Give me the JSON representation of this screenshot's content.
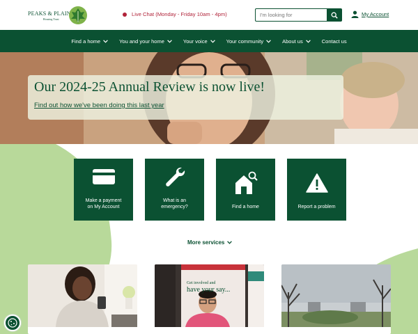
{
  "header": {
    "logo_name": "PEAKS & PLAINS",
    "logo_sub": "Housing Trust",
    "live_chat": "Live Chat (Monday - Friday 10am - 4pm)",
    "search_placeholder": "I'm looking for",
    "account_label": "My Account"
  },
  "nav": {
    "items": [
      {
        "label": "Find a home",
        "has_dropdown": true
      },
      {
        "label": "You and your home",
        "has_dropdown": true
      },
      {
        "label": "Your voice",
        "has_dropdown": true
      },
      {
        "label": "Your community",
        "has_dropdown": true
      },
      {
        "label": "About us",
        "has_dropdown": true
      },
      {
        "label": "Contact us",
        "has_dropdown": false
      }
    ]
  },
  "hero": {
    "title": "Our 2024-25 Annual Review is now live!",
    "link": "Find out how we've been doing this last year"
  },
  "services": {
    "tiles": [
      {
        "line1": "Make a payment",
        "line2": "on My Account",
        "icon": "card-icon"
      },
      {
        "line1": "What is an",
        "line2": "emergency?",
        "icon": "wrench-icon"
      },
      {
        "line1": "Find a home",
        "line2": "",
        "icon": "house-search-icon"
      },
      {
        "line1": "Report a problem",
        "line2": "",
        "icon": "warning-icon"
      }
    ],
    "more": "More services"
  },
  "cards": {
    "card2_sign": [
      "Get involved and",
      "have your say..."
    ]
  },
  "colors": {
    "brand": "#0b5132",
    "accent_light": "#b8d99a",
    "live_dot": "#b1243a"
  }
}
